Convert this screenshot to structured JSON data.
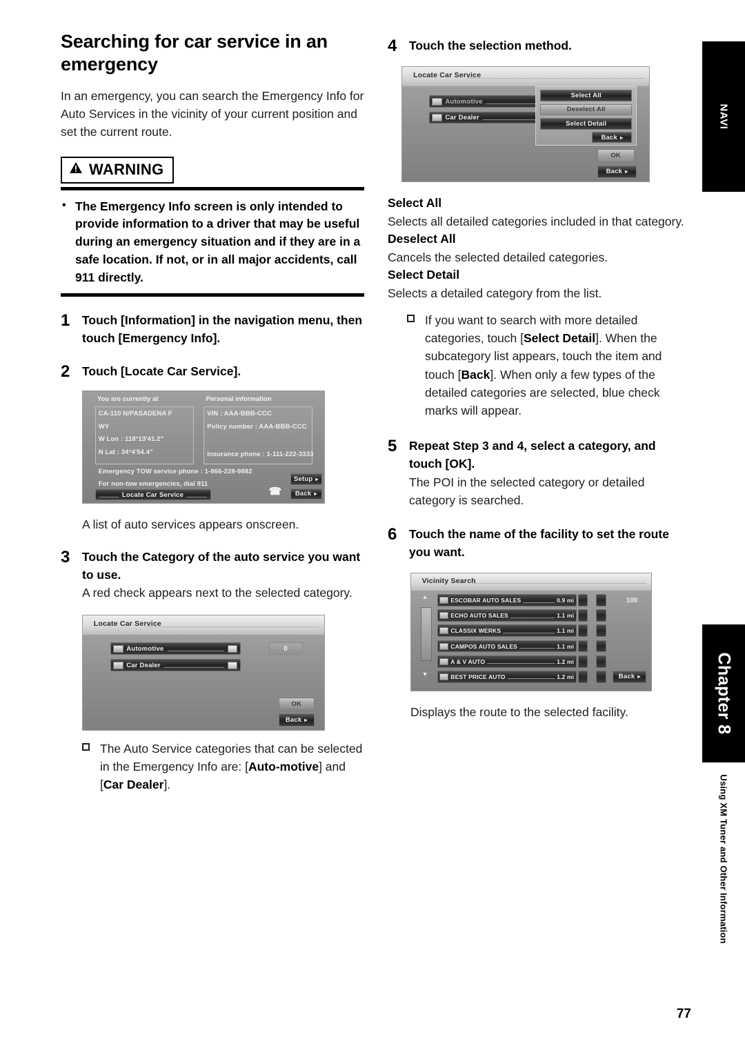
{
  "page": {
    "number": "77",
    "margin_tab_navi": "NAVI",
    "margin_tab_chapter": "Chapter 8",
    "margin_tab_subtitle": "Using XM Tuner and Other Information"
  },
  "left": {
    "title": "Searching for car service in an emergency",
    "intro": "In an emergency, you can search the Emergency Info for Auto Services in the vicinity of your current position and set the current route.",
    "warning": {
      "label": "WARNING",
      "icon": "warning-triangle-icon",
      "items": [
        "The Emergency Info screen is only intended to provide information to a driver that may be useful during an emergency situation and if they are in a safe location. If not, or in all major accidents, call 911 directly."
      ]
    },
    "steps": [
      {
        "num": "1",
        "text": "Touch [Information] in the navigation menu, then touch [Emergency Info]."
      },
      {
        "num": "2",
        "text": "Touch [Locate Car Service]."
      }
    ],
    "caption_after_shot1": "A list of auto services appears onscreen.",
    "step3": {
      "num": "3",
      "text": "Touch the Category of the auto service you want to use.",
      "sub": "A red check appears next to the selected category."
    },
    "note1": {
      "pre": "The Auto Service categories that can be selected in the Emergency Info are: [",
      "bold1": "Auto-motive",
      "mid": "] and [",
      "bold2": "Car Dealer",
      "post": "]."
    }
  },
  "right": {
    "step4": {
      "num": "4",
      "text": "Touch the selection method."
    },
    "definitions": [
      {
        "term": "Select All",
        "desc": "Selects all detailed categories included in that category."
      },
      {
        "term": "Deselect All",
        "desc": "Cancels the selected detailed categories."
      },
      {
        "term": "Select Detail",
        "desc": "Selects a detailed category from the list."
      }
    ],
    "note2": {
      "p1": "If you want to search with more detailed categories, touch [",
      "b1": "Select Detail",
      "p2": "]. When the subcategory list appears, touch the item and touch [",
      "b2": "Back",
      "p3": "]. When only a few types of the detailed categories are selected, blue check marks will appear."
    },
    "step5": {
      "num": "5",
      "text": "Repeat Step 3 and 4, select a category, and touch [OK].",
      "sub": "The POI in the selected category or detailed category is searched."
    },
    "step6": {
      "num": "6",
      "text": "Touch the name of the facility to set the route you want.",
      "sub": "Displays the route to the selected facility."
    }
  },
  "screens": {
    "personal_info": {
      "left_header": "You are currently at",
      "right_header": "Personal information",
      "address_line1": "CA-110 N/PASADENA F",
      "address_line2": "WY",
      "lon": "W Lon : 118°13'41.2\"",
      "lat": "N Lat : 34°4'54.4\"",
      "vin": "VIN : AAA-BBB-CCC",
      "policy": "Policy number : AAA-BBB-CCC",
      "insurance_phone": "Insurance phone : 1-111-222-3333",
      "tow_phone": "Emergency TOW service phone : 1-866-228-9882",
      "nontow": "For non-tow emergencies, dial  911",
      "locate_button": "Locate Car Service",
      "setup_button": "Setup",
      "back_button": "Back",
      "phone_icon": "phone-handset-icon"
    },
    "locate_car_service": {
      "title": "Locate Car Service",
      "rows": [
        {
          "label": "Automotive",
          "icon": "automotive-icon"
        },
        {
          "label": "Car Dealer",
          "icon": "car-dealer-icon"
        }
      ],
      "count": "0",
      "ok_button": "OK",
      "back_button": "Back"
    },
    "selection_method": {
      "title": "Locate Car Service",
      "rows": [
        {
          "label": "Automotive",
          "icon": "automotive-icon"
        },
        {
          "label": "Car Dealer",
          "icon": "car-dealer-icon"
        }
      ],
      "popup": {
        "select_all": "Select All",
        "deselect_all": "Deselect All",
        "select_detail": "Select Detail",
        "back": "Back"
      },
      "ok_button": "OK",
      "back_button": "Back"
    },
    "vicinity_search": {
      "title": "Vicinity Search",
      "count": "100",
      "back_button": "Back",
      "items": [
        {
          "name": "ESCOBAR AUTO SALES",
          "distance": "0.9 mi"
        },
        {
          "name": "ECHO AUTO SALES",
          "distance": "1.1 mi"
        },
        {
          "name": "CLASSIX WERKS",
          "distance": "1.1 mi"
        },
        {
          "name": "CAMPOS AUTO SALES",
          "distance": "1.1 mi"
        },
        {
          "name": "A & V AUTO",
          "distance": "1.2 mi"
        },
        {
          "name": "BEST PRICE AUTO",
          "distance": "1.2 mi"
        }
      ]
    }
  }
}
